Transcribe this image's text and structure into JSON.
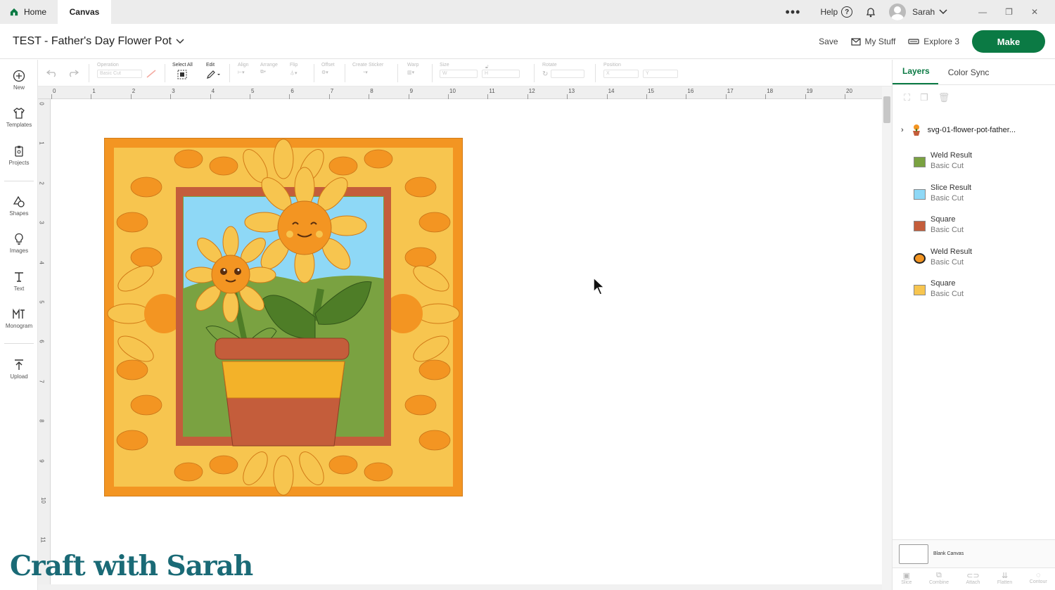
{
  "titlebar": {
    "home_tab": "Home",
    "canvas_tab": "Canvas",
    "help": "Help",
    "user": "Sarah",
    "dots": "•••"
  },
  "header": {
    "project_title": "TEST - Father's Day Flower Pot",
    "save": "Save",
    "my_stuff": "My Stuff",
    "machine": "Explore 3",
    "make": "Make"
  },
  "sidebar": {
    "items": [
      {
        "label": "New",
        "icon": "plus-circle-icon"
      },
      {
        "label": "Templates",
        "icon": "tshirt-icon"
      },
      {
        "label": "Projects",
        "icon": "clipboard-icon"
      },
      {
        "label": "Shapes",
        "icon": "shapes-icon"
      },
      {
        "label": "Images",
        "icon": "lightbulb-icon"
      },
      {
        "label": "Text",
        "icon": "text-icon"
      },
      {
        "label": "Monogram",
        "icon": "monogram-icon"
      },
      {
        "label": "Upload",
        "icon": "upload-icon"
      }
    ]
  },
  "toolbar": {
    "operation_label": "Operation",
    "operation_value": "Basic Cut",
    "select_all": "Select All",
    "edit": "Edit",
    "align": "Align",
    "arrange": "Arrange",
    "flip": "Flip",
    "offset": "Offset",
    "create_sticker": "Create Sticker",
    "warp": "Warp",
    "size": "Size",
    "size_w": "W",
    "size_h": "H",
    "rotate": "Rotate",
    "position": "Position",
    "pos_x": "X",
    "pos_y": "Y"
  },
  "ruler": {
    "h": [
      "0",
      "1",
      "2",
      "3",
      "4",
      "5",
      "6",
      "7",
      "8",
      "9",
      "10",
      "11",
      "12",
      "13",
      "14",
      "15",
      "16",
      "17",
      "18",
      "19",
      "20"
    ],
    "v": [
      "0",
      "1",
      "2",
      "3",
      "4",
      "5",
      "6",
      "7",
      "8",
      "9",
      "10",
      "11"
    ]
  },
  "layers_panel": {
    "tabs": [
      "Layers",
      "Color Sync"
    ],
    "group_name": "svg-01-flower-pot-father...",
    "layers": [
      {
        "name": "Weld Result",
        "op": "Basic Cut",
        "color": "#7aa241"
      },
      {
        "name": "Slice Result",
        "op": "Basic Cut",
        "color": "#8ed8f6"
      },
      {
        "name": "Square",
        "op": "Basic Cut",
        "color": "#c45d3b"
      },
      {
        "name": "Weld Result",
        "op": "Basic Cut",
        "color": "#f39522"
      },
      {
        "name": "Square",
        "op": "Basic Cut",
        "color": "#f7c54f"
      }
    ],
    "blank_canvas": "Blank Canvas",
    "bottom_tools": [
      "Slice",
      "Combine",
      "Attach",
      "Flatten",
      "Contour"
    ]
  },
  "colors": {
    "accent": "#0b7a44",
    "orange": "#f39522",
    "yellow": "#f7c54f",
    "brown": "#c45d3b",
    "green": "#7aa241",
    "sky": "#8ed8f6",
    "dark_green": "#4e7d27"
  },
  "watermark": "Craft with Sarah"
}
